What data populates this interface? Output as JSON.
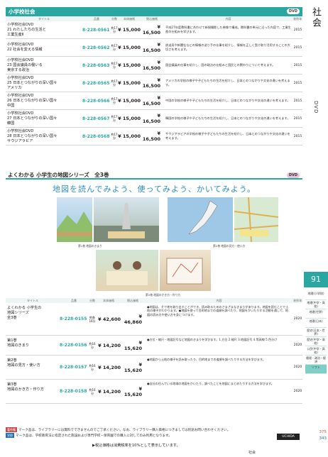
{
  "side": {
    "category": "社会",
    "media": "DVD",
    "page_number": "91",
    "nav": [
      "地理(小学校)",
      "地理(中学・高校)",
      "地理(世界)",
      "地理(日本)",
      "歴史(日本・世界)",
      "歴史(中学・高校)",
      "公民(中学・高校)",
      "倫理・政治・経済",
      "ソフト"
    ],
    "page_ref_1": "375",
    "page_ref_2": "343"
  },
  "sec1": {
    "title": "小学校社会",
    "badge": "DVD",
    "columns": [
      "タイトル",
      "品番",
      "分数",
      "本体価格",
      "税込価格",
      "内容",
      "制作年"
    ],
    "rows": [
      {
        "title": "小学校社会DVD\n21 わたしたちの生活と\n工業生産Ⅱ",
        "code": "8-228-0561",
        "min": "約17分",
        "p1": "¥ 15,000",
        "p2": "¥ 16,500",
        "desc": "平成27年度教科書に合わせて新規撮影した映像で構成。教科書の単元に沿った内容で、工業生産の仕組みを学びます。",
        "year": "2015"
      },
      {
        "title": "小学校社会DVD\n22 社会を変える情報",
        "code": "8-228-0562",
        "min": "約17分",
        "p1": "¥ 15,000",
        "p2": "¥ 16,500",
        "desc": "放送局や新聞社などの情報の送り手の仕事を紹介し、情報を正しく受け取り活用することの大切さを考えます。",
        "year": "2015"
      },
      {
        "title": "小学校社会DVD\n23 国会議員の働いる\n東京する政治",
        "code": "8-228-0563",
        "min": "約17分",
        "p1": "¥ 15,000",
        "p2": "¥ 16,500",
        "desc": "国会議員の仕事を紹介し、国の政治の仕組みと国民との関わりについて考えます。",
        "year": "2015"
      },
      {
        "title": "小学校社会DVD\n25 日本とつながりの深い国々\nアメリカ",
        "code": "8-228-0565",
        "min": "約17分",
        "p1": "¥ 15,000",
        "p2": "¥ 16,500",
        "desc": "アメリカの学校の様子や子どもたちの生活を紹介し、日本とのつながりや文化の違いを考えます。",
        "year": "2015"
      },
      {
        "title": "小学校社会DVD\n26 日本とつながりの深い国々\n中国",
        "code": "8-228-0566",
        "min": "約17分",
        "p1": "¥ 15,000",
        "p2": "¥ 16,500",
        "desc": "中国の学校の様子や子どもたちの生活を紹介し、日本とのつながりや文化の違いを考えます。",
        "year": "2015"
      },
      {
        "title": "小学校社会DVD\n27 日本とつながりの深い国々\n韓国",
        "code": "8-228-0567",
        "min": "約17分",
        "p1": "¥ 15,000",
        "p2": "¥ 16,500",
        "desc": "韓国の学校の様子や子どもたちの生活を紹介し、日本とのつながりや文化の違いを考えます。",
        "year": "2015"
      },
      {
        "title": "小学校社会DVD\n28 日本とつながりの深い国々\nサウジアラビア",
        "code": "8-228-0568",
        "min": "約17分",
        "p1": "¥ 15,000",
        "p2": "¥ 16,500",
        "desc": "サウジアラビアの学校の様子や子どもたちの生活を紹介し、日本とのつながりや文化の違いを考えます。",
        "year": "2015"
      }
    ]
  },
  "sec2": {
    "title": "よくわかる 小学生の地図シリーズ　全3巻",
    "badge": "DVD",
    "tagline": "地図を読んでみよう、使ってみよう、かいてみよう。",
    "captions": [
      "第1巻 地図のきまり",
      "第2巻 地図の見方・使い方",
      "第3巻 地図のかき方・作り方"
    ],
    "columns": [
      "タイトル",
      "品番",
      "分数",
      "本体価格",
      "税込価格",
      "内容",
      "制作年"
    ],
    "rows": [
      {
        "title": "よくわかる 小学生の\n地図シリーズ\n全3巻",
        "code": "8-228-0155",
        "min": "約各16分",
        "p1": "¥ 42,600",
        "p2": "¥ 46,860",
        "desc": "●地図は、そで地を取り出すことができ、読み取るためのさまざまなきまりがあります。地図を読むことで土地の様子がわかります。●地図を使って目的地までの道順を調べたり、地図をかいたりする活動を通して、地図の読み方や使い方を身につけます。",
        "year": "2020"
      },
      {
        "title": "第1巻\n地図のきまり",
        "code": "8-228-0156",
        "min": "約16分",
        "p1": "¥ 14,200",
        "p2": "¥ 15,620",
        "desc": "●方位・縮尺・地図記号など地図のきまりを学びます。1.方位 2.縮尺 3.地図記号 4.等高線 5.色分け",
        "year": "2020"
      },
      {
        "title": "第2巻\n地図の見方・使い方",
        "code": "8-228-0157",
        "min": "約16分",
        "p1": "¥ 14,200",
        "p2": "¥ 15,620",
        "desc": "●地図から土地の様子を読み取ったり、目的地までの道順を調べたりする方法を学びます。",
        "year": "2020"
      },
      {
        "title": "第3巻\n地図のかき方・作り方",
        "code": "8-228-0158",
        "min": "約16分",
        "p1": "¥ 14,200",
        "p2": "¥ 15,620",
        "desc": "●自分の住んでいる地域の地図をかいたり、調べたことを地図にまとめたりする方法を学びます。",
        "year": "2020"
      }
    ]
  },
  "legend": {
    "line1_badge": "著作権",
    "line1": "マーク品は、ライブラリーには無料でできませんのでご了承ください。なお、ライブラリー購入価格につきましては別途お問い合わせください。",
    "line2_badge": "学校",
    "line2": "マーク品は、学校教育法に指定された施設および専門学校・保育園での購入に対してのみ利用となります。",
    "foot": "▶税込価格は消費税率を10%として表示しています。",
    "logo": "UCHIDA",
    "page_label": "社会"
  },
  "colors": {
    "accent": "#2aa7a0",
    "blue": "#2a8fc9",
    "pink": "#e9c3d9"
  }
}
